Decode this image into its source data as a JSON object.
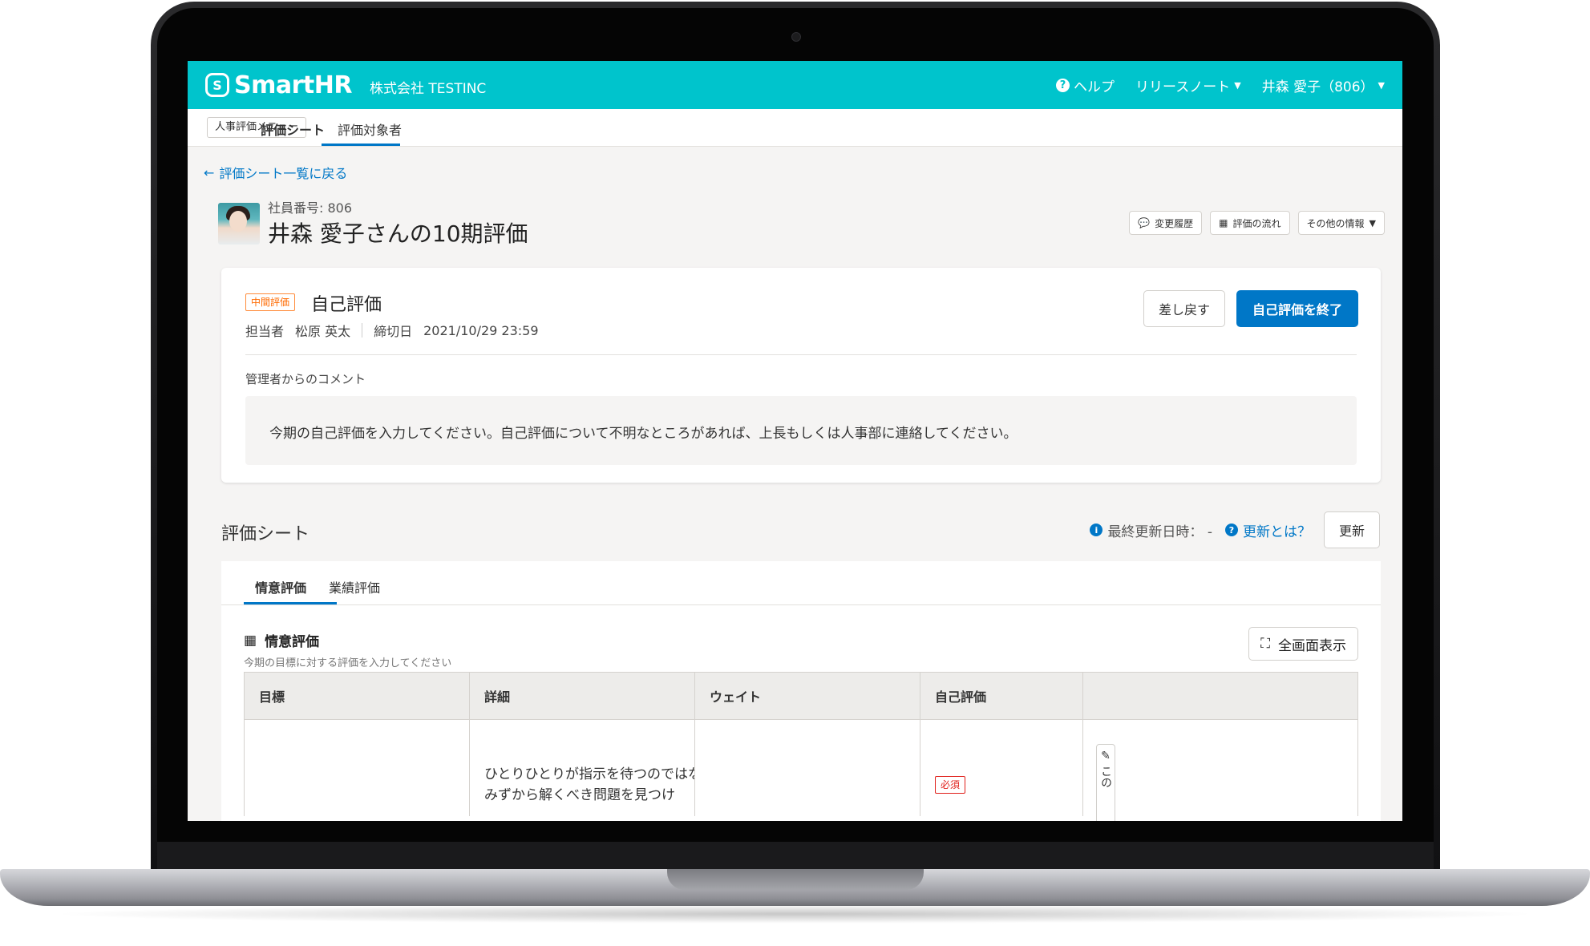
{
  "header": {
    "logo_text": "SmartHR",
    "company": "株式会社 TESTINC",
    "help": "ヘルプ",
    "release_notes": "リリースノート",
    "user": "井森 愛子（806）"
  },
  "subnav": {
    "menu_button": "人事評価メニュー",
    "tabs": [
      {
        "label": "評価シート",
        "active": true
      },
      {
        "label": "評価対象者",
        "active": false
      }
    ]
  },
  "page": {
    "back_link": "評価シート一覧に戻る",
    "employee_number": "社員番号: 806",
    "title": "井森 愛子さんの10期評価",
    "actions": {
      "history": "変更履歴",
      "flow": "評価の流れ",
      "other_info": "その他の情報"
    }
  },
  "card": {
    "badge": "中間評価",
    "title": "自己評価",
    "assignee_label": "担当者",
    "assignee": "松原 英太",
    "deadline_label": "締切日",
    "deadline": "2021/10/29 23:59",
    "return_button": "差し戻す",
    "finish_button": "自己評価を終了",
    "comment_label": "管理者からのコメント",
    "comment": "今期の自己評価を入力してください。自己評価について不明なところがあれば、上長もしくは人事部に連絡してください。"
  },
  "sheet": {
    "title": "評価シート",
    "last_updated": "最終更新日時： -",
    "what_is_update": "更新とは？",
    "update_button": "更新",
    "tabs": [
      {
        "label": "情意評価",
        "active": true
      },
      {
        "label": "業績評価",
        "active": false
      }
    ],
    "section_title": "情意評価",
    "section_desc": "今期の目標に対する評価を入力してください",
    "fullscreen_button": "全画面表示",
    "columns": [
      "目標",
      "詳細",
      "ウェイト",
      "自己評価",
      ""
    ],
    "rows": [
      {
        "goal": "",
        "detail": "ひとりひとりが指示を待つのではなく、みずから解くべき問題を見つけ",
        "weight": "",
        "required_badge": "必須",
        "edit_label": "この"
      }
    ]
  },
  "colors": {
    "header_bg": "#00c4cc",
    "primary": "#0077c7",
    "badge_orange": "#ff6a00",
    "required_red": "#e0201b"
  }
}
